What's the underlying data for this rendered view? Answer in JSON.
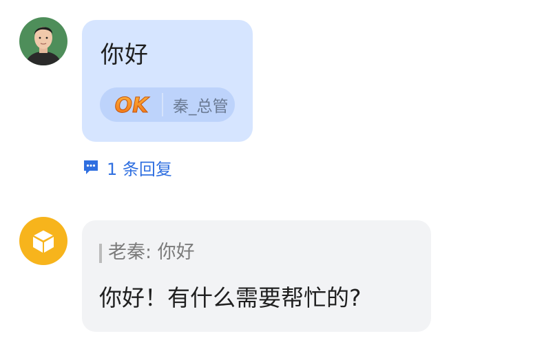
{
  "messages": [
    {
      "sender_avatar": "user-portrait-avatar",
      "text": "你好",
      "reaction": {
        "emoji": "OK",
        "user": "秦_总管"
      },
      "replies_label": "1 条回复"
    },
    {
      "sender_avatar": "cube-bot-avatar",
      "quote": "老秦: 你好",
      "text": "你好！有什么需要帮忙的?"
    }
  ],
  "colors": {
    "bubble_self": "#d6e5ff",
    "bubble_other": "#f2f3f5",
    "reaction_chip": "#bdd3fb",
    "link_blue": "#2f6fe0",
    "ok_orange": "#f2871b",
    "bot_avatar_yellow": "#f7b41c"
  }
}
